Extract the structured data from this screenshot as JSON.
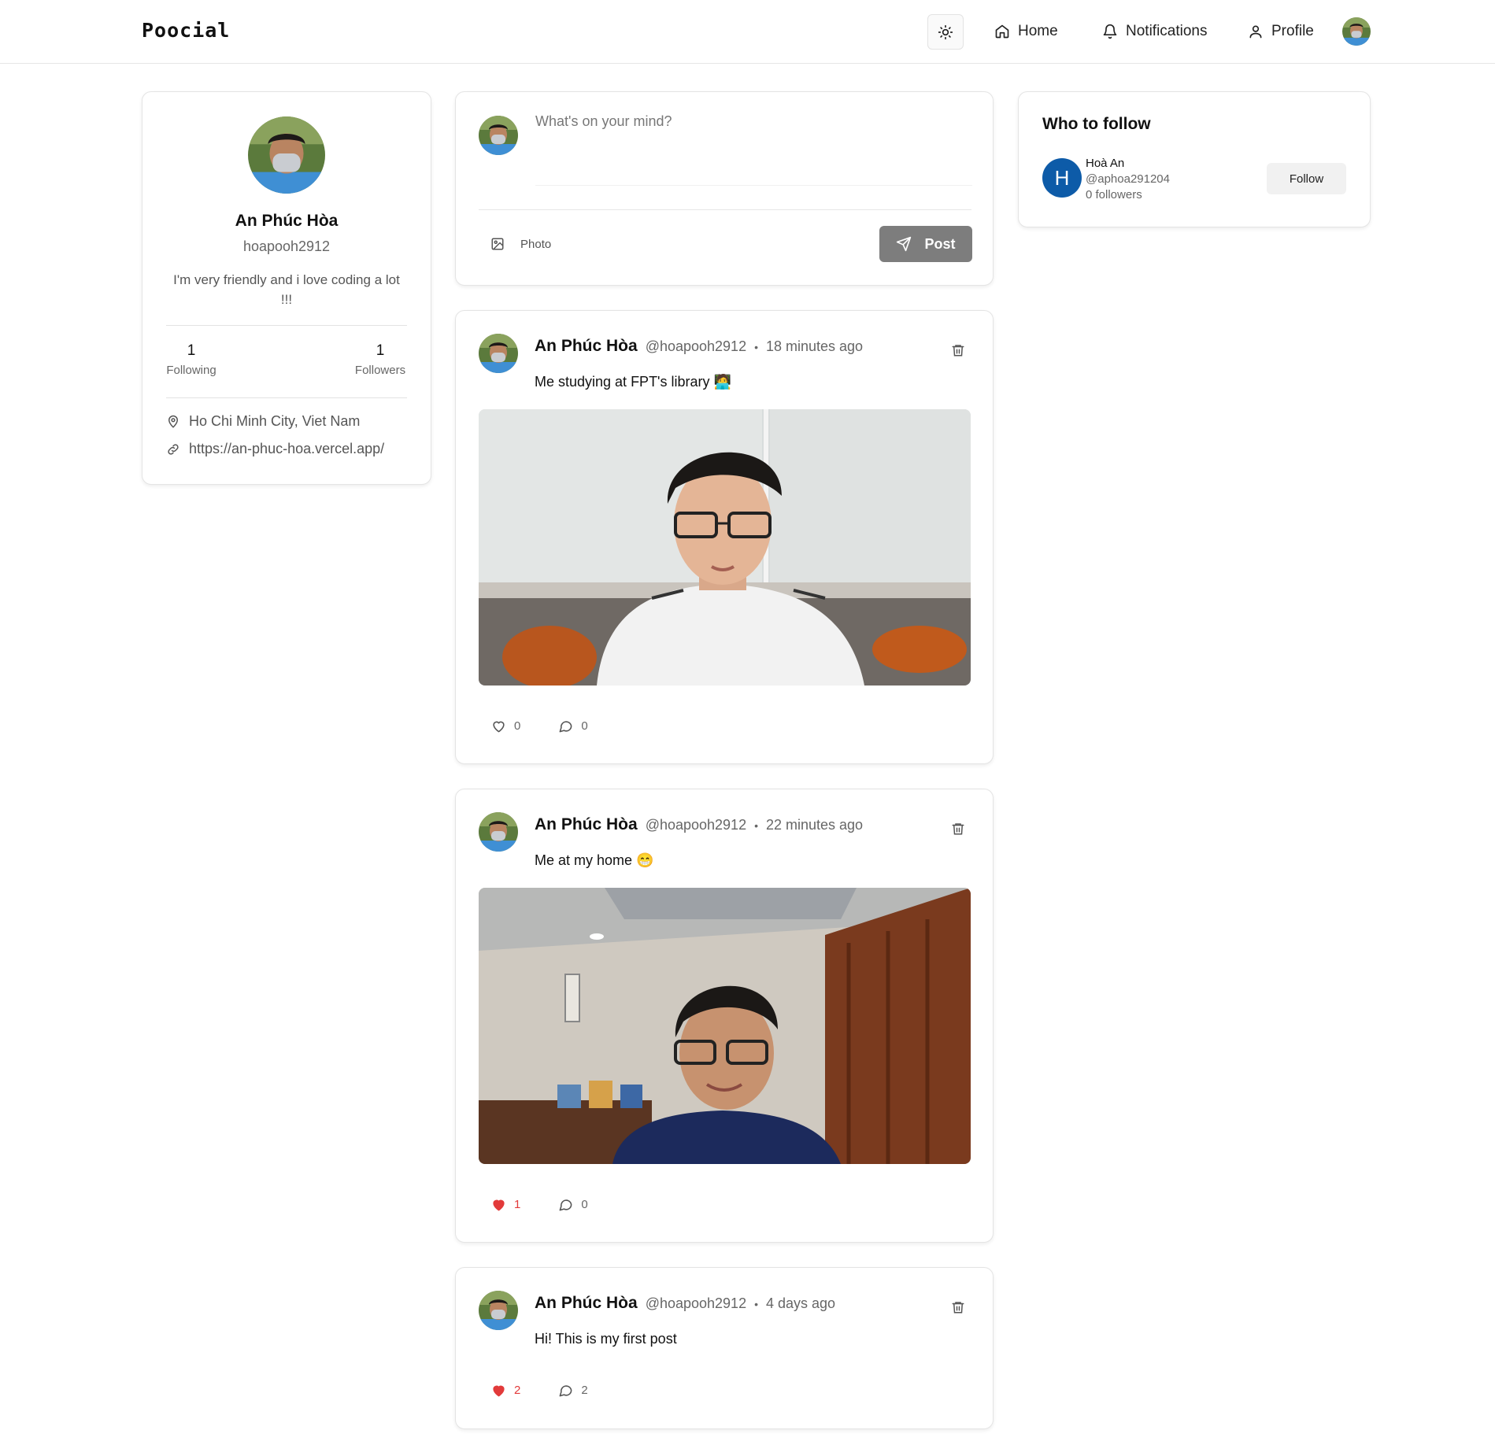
{
  "app": {
    "logo": "Poocial"
  },
  "nav": {
    "home": "Home",
    "notifications": "Notifications",
    "profile": "Profile"
  },
  "profile": {
    "name": "An Phúc Hòa",
    "handle": "hoapooh2912",
    "bio": "I'm very friendly and i love coding a lot !!!",
    "following_count": "1",
    "following_label": "Following",
    "followers_count": "1",
    "followers_label": "Followers",
    "location": "Ho Chi Minh City, Viet Nam",
    "website": "https://an-phuc-hoa.vercel.app/"
  },
  "composer": {
    "placeholder": "What's on your mind?",
    "photo_label": "Photo",
    "post_label": "Post"
  },
  "posts": [
    {
      "author": "An Phúc Hòa",
      "handle": "@hoapooh2912",
      "separator": "•",
      "time": "18 minutes ago",
      "text": "Me studying at FPT's library 🧑‍💻",
      "likes": "0",
      "comments": "0",
      "liked": false
    },
    {
      "author": "An Phúc Hòa",
      "handle": "@hoapooh2912",
      "separator": "•",
      "time": "22 minutes ago",
      "text": "Me at my home 😁",
      "likes": "1",
      "comments": "0",
      "liked": true
    },
    {
      "author": "An Phúc Hòa",
      "handle": "@hoapooh2912",
      "separator": "•",
      "time": "4 days ago",
      "text": "Hi! This is my first post",
      "likes": "2",
      "comments": "2",
      "liked": true
    }
  ],
  "who_to_follow": {
    "title": "Who to follow",
    "users": [
      {
        "initial": "H",
        "name": "Hoà An",
        "handle": "@aphoa291204",
        "followers": "0 followers",
        "button": "Follow"
      }
    ]
  },
  "colors": {
    "like_active": "#e23a3a",
    "post_button": "#7d7d7d",
    "follow_avatar": "#0d5ba8"
  }
}
